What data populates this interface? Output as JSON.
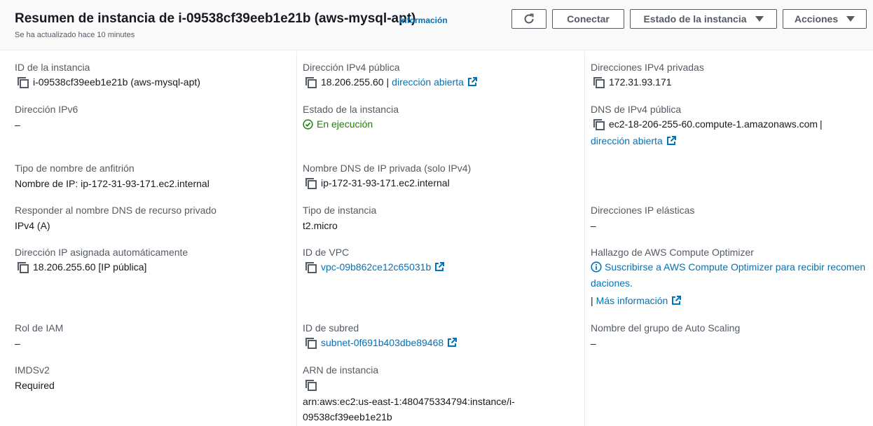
{
  "header": {
    "title": "Resumen de instancia de i-09538cf39eeb1e21b (aws-mysql-apt)",
    "info_label": "Información",
    "subtitle": "Se ha actualizado hace 10 minutes",
    "buttons": {
      "connect": "Conectar",
      "instance_state": "Estado de la instancia",
      "actions": "Acciones"
    }
  },
  "col1": {
    "instance_id": {
      "label": "ID de la instancia",
      "value": "i-09538cf39eeb1e21b (aws-mysql-apt)"
    },
    "ipv6": {
      "label": "Dirección IPv6",
      "value": "–"
    },
    "hostname_type": {
      "label": "Tipo de nombre de anfitrión",
      "value": "Nombre de IP: ip-172-31-93-171.ec2.internal"
    },
    "dns_answer": {
      "label": "Responder al nombre DNS de recurso privado",
      "value": "IPv4 (A)"
    },
    "auto_ip": {
      "label": "Dirección IP asignada automáticamente",
      "value": "18.206.255.60 [IP pública]"
    },
    "iam_role": {
      "label": "Rol de IAM",
      "value": "–"
    },
    "imdsv2": {
      "label": "IMDSv2",
      "value": "Required"
    }
  },
  "col2": {
    "public_ipv4": {
      "label": "Dirección IPv4 pública",
      "value": "18.206.255.60",
      "separator": "|",
      "link": "dirección abierta"
    },
    "instance_state": {
      "label": "Estado de la instancia",
      "value": "En ejecución"
    },
    "private_dns": {
      "label": "Nombre DNS de IP privada (solo IPv4)",
      "value": "ip-172-31-93-171.ec2.internal"
    },
    "instance_type": {
      "label": "Tipo de instancia",
      "value": "t2.micro"
    },
    "vpc_id": {
      "label": "ID de VPC",
      "value": "vpc-09b862ce12c65031b"
    },
    "subnet_id": {
      "label": "ID de subred",
      "value": "subnet-0f691b403dbe89468"
    },
    "arn": {
      "label": "ARN de instancia",
      "value_line1": "arn:aws:ec2:us-east-1:480475334794:instance/i-",
      "value_line2": "09538cf39eeb1e21b"
    }
  },
  "col3": {
    "private_ipv4": {
      "label": "Direcciones IPv4 privadas",
      "value": "172.31.93.171"
    },
    "public_dns": {
      "label": "DNS de IPv4 pública",
      "value": "ec2-18-206-255-60.compute-1.amazonaws.com",
      "separator": "|",
      "link": "dirección abierta"
    },
    "elastic_ip": {
      "label": "Direcciones IP elásticas",
      "value": "–"
    },
    "optimizer": {
      "label": "Hallazgo de AWS Compute Optimizer",
      "link_line1": "Suscribirse a AWS Compute Optimizer para recibir recomen",
      "link_line2": "daciones.",
      "separator": "|",
      "more_link": "Más información"
    },
    "asg": {
      "label": "Nombre del grupo de Auto Scaling",
      "value": "–"
    }
  },
  "colors": {
    "link": "#0073bb",
    "running": "#1d8102",
    "label": "#545b64",
    "text": "#16191f"
  },
  "icons": {
    "copy": "copy-icon",
    "external": "external-link-icon",
    "info": "info-icon",
    "status": "check-circle-icon",
    "refresh": "refresh-icon",
    "caret": "caret-down-icon"
  }
}
